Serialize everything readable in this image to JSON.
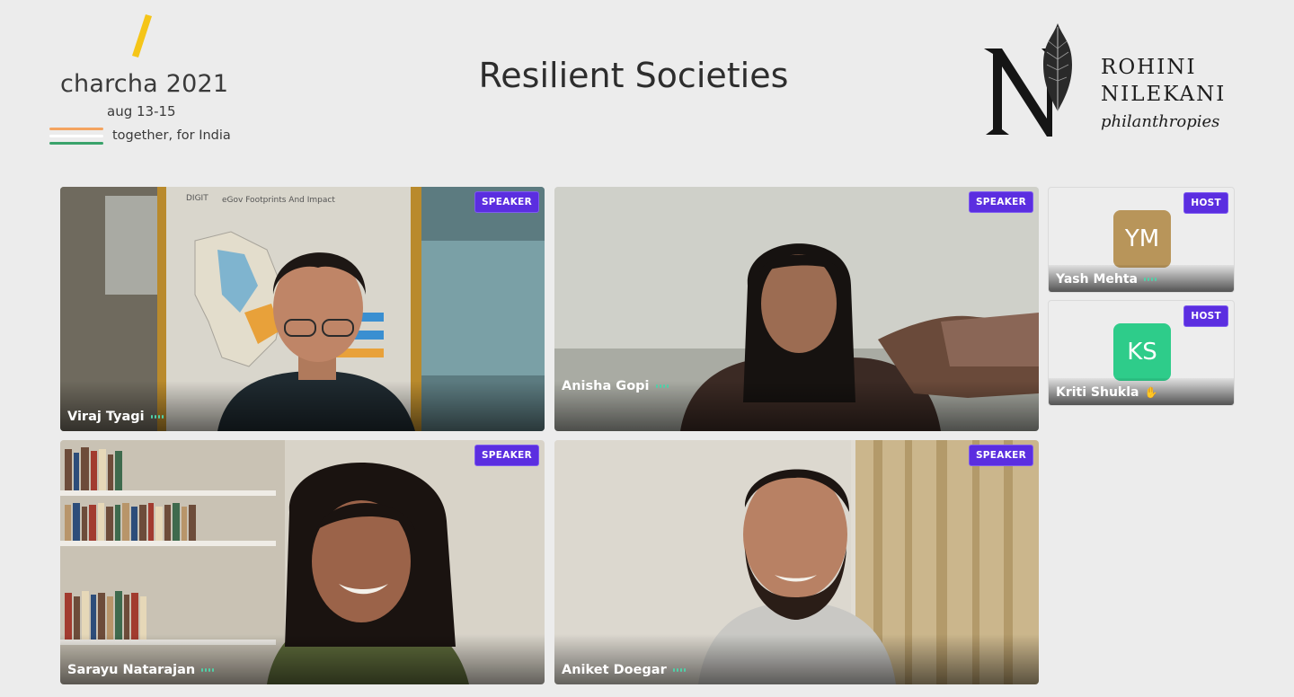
{
  "event": {
    "name": "charcha 2021",
    "dates": "aug 13-15",
    "tagline": "together, for India"
  },
  "session_title": "Resilient Societies",
  "organizer": {
    "line1": "ROHINI",
    "line2": "NILEKANI",
    "line3": "philanthropies"
  },
  "speakers": [
    {
      "name": "Viraj Tyagi",
      "role": "SPEAKER",
      "backdrop_text_1": "DIGIT",
      "backdrop_text_2": "eGov Footprints And Impact"
    },
    {
      "name": "Anisha Gopi",
      "role": "SPEAKER"
    },
    {
      "name": "Sarayu Natarajan",
      "role": "SPEAKER"
    },
    {
      "name": "Aniket Doegar",
      "role": "SPEAKER"
    }
  ],
  "hosts": [
    {
      "name": "Yash Mehta",
      "initials": "YM",
      "role": "HOST",
      "avatar_color": "#b8955a",
      "status_icon": "mic-activity-icon"
    },
    {
      "name": "Kriti Shukla",
      "initials": "KS",
      "role": "HOST",
      "avatar_color": "#2ecc8a",
      "status_icon": "raised-hand-icon"
    }
  ],
  "colors": {
    "badge": "#5b2ee0",
    "mic_activity": "#4fd1a8",
    "event_accent": "#f5c518",
    "flag_saffron": "#f4a460",
    "flag_green": "#3aa36b"
  }
}
